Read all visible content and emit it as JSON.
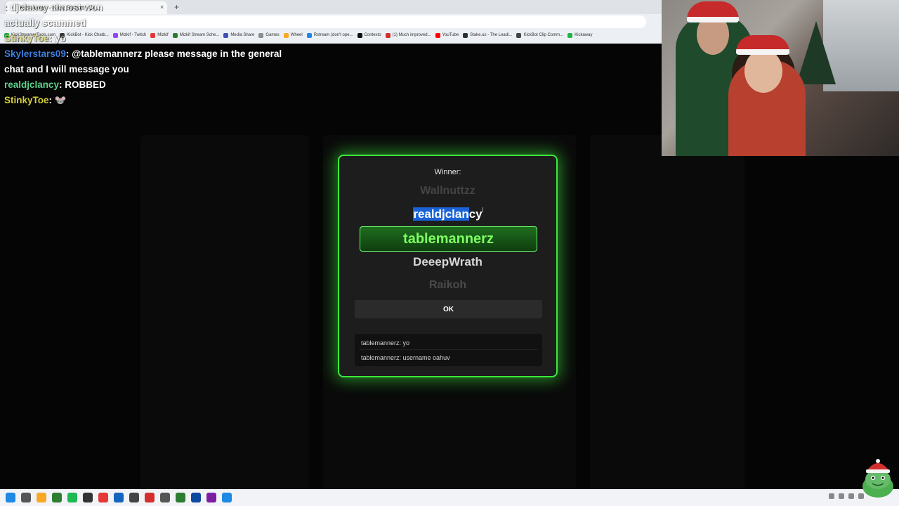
{
  "browser": {
    "tab_title": "KickAway - Kick Stream Gi...",
    "bookmarks": [
      {
        "label": "KickStreamerTools.com",
        "color": "#22b34a"
      },
      {
        "label": "KickBot - Kick Chatb...",
        "color": "#3a3a3a"
      },
      {
        "label": "Mizkif - Twitch",
        "color": "#9146ff"
      },
      {
        "label": "Mizkif",
        "color": "#e53935"
      },
      {
        "label": "Mizkif Stream Sche...",
        "color": "#2e7d32"
      },
      {
        "label": "Media Share",
        "color": "#3f51b5"
      },
      {
        "label": "Games",
        "color": "#8d8d8d"
      },
      {
        "label": "Wheel",
        "color": "#f9a825"
      },
      {
        "label": "Rstream (don't ope...",
        "color": "#1e88e5"
      },
      {
        "label": "Contexto",
        "color": "#111111"
      },
      {
        "label": "(1) Much improved...",
        "color": "#d32f2f"
      },
      {
        "label": "YouTube",
        "color": "#ff0000"
      },
      {
        "label": "Stake.us - The Leadi...",
        "color": "#263238"
      },
      {
        "label": "KickBot Clip Comm...",
        "color": "#444444"
      },
      {
        "label": "Kickaway",
        "color": "#22b34a"
      }
    ]
  },
  "chat": [
    {
      "user": "",
      "text": ": djclancy almost won",
      "user_color": "#aaaaaa",
      "faded": true
    },
    {
      "user": "",
      "text": "actually scammed",
      "user_color": "#cc8844",
      "faded": true
    },
    {
      "user": "StinkyToe",
      "text": ": yo",
      "user_color": "#d8d13a",
      "faded": true
    },
    {
      "user": "Skylerstars09",
      "text": ": @tablemannerz please message in the general chat and I will message you",
      "user_color": "#3d7fe0",
      "faded": false
    },
    {
      "user": "realdjclancy",
      "text": ": ROBBED",
      "user_color": "#5ed38a",
      "faded": false
    },
    {
      "user": "StinkyToe",
      "text": ": 🐭",
      "user_color": "#d8d13a",
      "faded": false
    }
  ],
  "modal": {
    "label": "Winner:",
    "slots": [
      "Wallnuttzz",
      "realdjclancy",
      "tablemannerz",
      "DeeepWrath",
      "Raikoh"
    ],
    "selected_part": "realdjclan",
    "rest_part": "cy",
    "ok_label": "OK",
    "messages": [
      "tablemannerz: yo",
      "tablemannerz: username oahuv"
    ]
  },
  "colors": {
    "accent_green": "#3ce83c",
    "winner_text": "#7dff62"
  },
  "taskbar_icons": [
    "windows-icon",
    "search-icon",
    "file-explorer-icon",
    "app-icon",
    "spotify-icon",
    "obs-icon",
    "chrome-icon",
    "edge-icon",
    "app-icon",
    "app-icon",
    "app-icon",
    "app-icon",
    "app-icon",
    "app-icon",
    "app-icon"
  ]
}
